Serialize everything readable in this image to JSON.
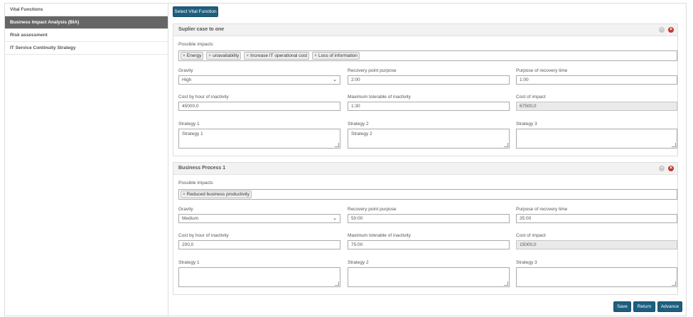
{
  "sidebar": {
    "items": [
      "Vital Functions",
      "Business Impact Analysis (BIA)",
      "Risk assessment",
      "IT Service Continuity Strategy"
    ]
  },
  "main": {
    "select_vital_function": "Select Vital Function",
    "labels": {
      "possible_impacts": "Possible impacts",
      "gravity": "Gravity",
      "recovery_point": "Recovery point purpose",
      "recovery_time": "Purpose of recovery time",
      "cost_hour": "Cost by hour of inactivity",
      "max_tolerable": "Maximum tolerable of inactivity",
      "cost_impact": "Cost of impact",
      "strategy1": "Strategy 1",
      "strategy2": "Strategy 2",
      "strategy3": "Strategy 3"
    },
    "panels": [
      {
        "title": "Suplier case to one",
        "impacts": [
          "Energy",
          "unavailability",
          "Increase IT operational cost",
          "Loss of information"
        ],
        "gravity": "High",
        "recovery_point": "2:00",
        "recovery_time": "1:00",
        "cost_hour": "45000,0",
        "max_tolerable": "1:30",
        "cost_impact": "67500,0",
        "strategy1": "Strategy 1",
        "strategy2": "Strategy 2",
        "strategy3": ""
      },
      {
        "title": "Business Process 1",
        "impacts": [
          "Reduced business productivity"
        ],
        "gravity": "Medium",
        "recovery_point": "50:00",
        "recovery_time": "35:00",
        "cost_hour": "200,0",
        "max_tolerable": "75:00",
        "cost_impact": "15000,0",
        "strategy1": "",
        "strategy2": "",
        "strategy3": ""
      }
    ],
    "footer": {
      "save": "Save",
      "return": "Return",
      "advance": "Advance"
    }
  },
  "icons": {
    "minimize": "minus-circle-icon",
    "close": "close-circle-icon",
    "chip_remove": "x-icon",
    "select_caret": "chevron-down-icon"
  },
  "colors": {
    "primary_button": "#1e5f7f",
    "active_sidebar": "#666666",
    "close_icon": "#c0392b"
  }
}
